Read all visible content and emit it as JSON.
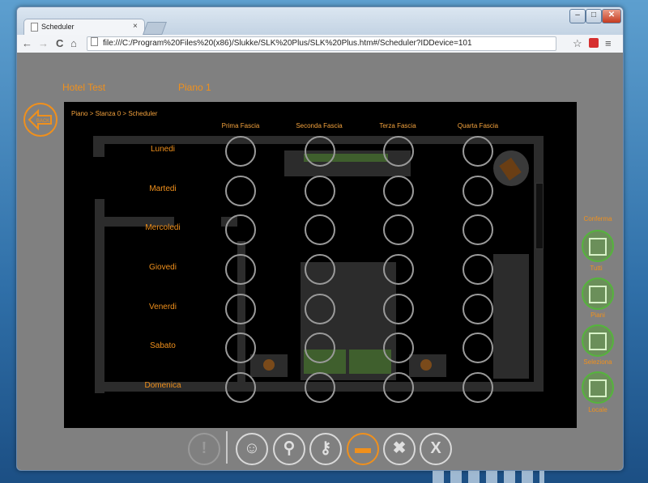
{
  "browser": {
    "tab_title": "Scheduler",
    "tab_close": "×",
    "url": "file:///C:/Program%20Files%20(x86)/Slukke/SLK%20Plus/SLK%20Plus.htm#/Scheduler?IDDevice=101",
    "nav": {
      "back": "←",
      "forward": "→",
      "reload": "C",
      "home": "⌂"
    },
    "star": "☆",
    "menu": "≡",
    "window_buttons": {
      "minimize": "–",
      "maximize": "□",
      "close": "✕"
    }
  },
  "app": {
    "hotel_name": "Hotel Test",
    "floor": "Piano 1",
    "back_label": "BACK",
    "breadcrumb": [
      "Piano",
      ">",
      "Stanza 0",
      ">",
      "Scheduler"
    ],
    "columns": [
      "Prima Fascia",
      "Seconda Fascia",
      "Terza Fascia",
      "Quarta Fascia"
    ],
    "days": [
      "Lunedi",
      "Martedi",
      "Mercoledi",
      "Giovedi",
      "Venerdi",
      "Sabato",
      "Domenica"
    ],
    "right_panel": {
      "conferma": "Conferma",
      "tutti": "Tutti",
      "piani": "Piani",
      "selezione": "Seleziona",
      "locale": "Locale"
    },
    "bottom_icons": [
      "alert-icon",
      "person-icon",
      "search-icon",
      "key-icon",
      "bed-icon",
      "tools-icon",
      "close-icon"
    ],
    "bottom_glyphs": [
      "!",
      "☺",
      "⚲",
      "⚷",
      "▬",
      "✖",
      "X"
    ]
  },
  "colors": {
    "accent": "#f0901c",
    "confirm_green": "#55b43c",
    "slot_border": "#9a9a9a"
  }
}
